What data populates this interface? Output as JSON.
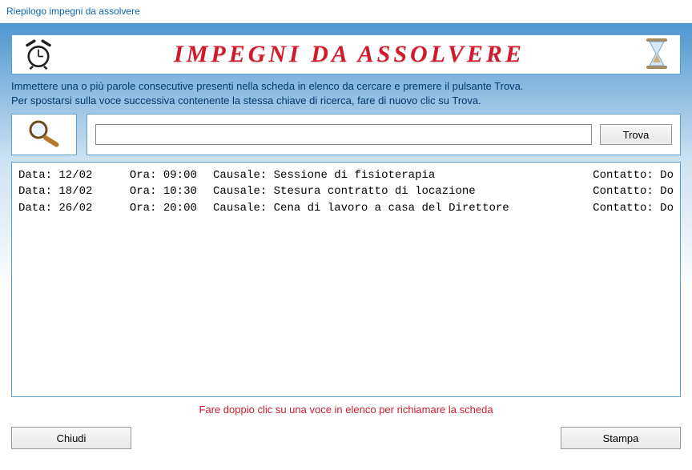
{
  "window": {
    "title": "Riepilogo impegni da assolvere"
  },
  "banner": {
    "title": "IMPEGNI DA ASSOLVERE"
  },
  "instructions": {
    "line1": "Immettere una o più parole consecutive presenti nella scheda in elenco da cercare e premere il pulsante Trova.",
    "line2": "Per spostarsi sulla voce successiva contenente la stessa chiave di ricerca, fare di nuovo clic su Trova."
  },
  "search": {
    "value": "",
    "placeholder": "",
    "button": "Trova"
  },
  "labels": {
    "data": "Data: ",
    "ora": "Ora: ",
    "causale": "Causale: ",
    "contatto": "Contatto: "
  },
  "rows": [
    {
      "data": "12/02",
      "ora": "09:00",
      "causale": "Sessione di fisioterapia",
      "contatto": "Do"
    },
    {
      "data": "18/02",
      "ora": "10:30",
      "causale": "Stesura contratto di locazione",
      "contatto": "Do"
    },
    {
      "data": "26/02",
      "ora": "20:00",
      "causale": "Cena di lavoro a casa del Direttore",
      "contatto": "Do"
    }
  ],
  "hint": "Fare doppio clic su una voce in elenco per richiamare la scheda",
  "footer": {
    "close": "Chiudi",
    "print": "Stampa"
  }
}
